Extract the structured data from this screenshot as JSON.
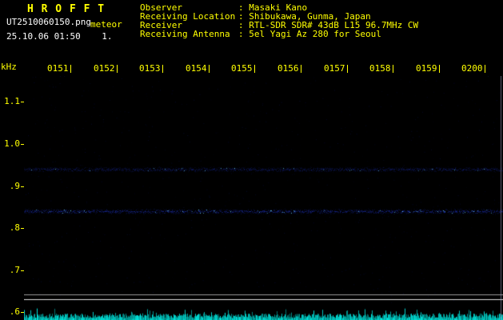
{
  "header": {
    "app_title": "H R O F F T",
    "filename": "UT2510060150.png",
    "mode": "meteor",
    "datetime_line": "25.10.06 01:50    1.",
    "info": [
      {
        "label": "Observer",
        "value": "Masaki Kano"
      },
      {
        "label": "Receiving Location",
        "value": "Shibukawa, Gunma, Japan"
      },
      {
        "label": "Receiver",
        "value": "RTL-SDR SDR# 43dB L15 96.7MHz CW"
      },
      {
        "label": "Receiving Antenna",
        "value": "5el Yagi Az 280 for Seoul"
      }
    ]
  },
  "chart_data": {
    "type": "heatmap",
    "title": "HROFFT meteor radio observation spectrogram",
    "ylabel": "kHz",
    "y_ticks": [
      {
        "label": "1.1",
        "khz": 1.1
      },
      {
        "label": "1.0",
        "khz": 1.0
      },
      {
        "label": ".9",
        "khz": 0.9
      },
      {
        "label": ".8",
        "khz": 0.8
      },
      {
        "label": ".7",
        "khz": 0.7
      },
      {
        "label": ".6",
        "khz": 0.6
      }
    ],
    "x_ticks": [
      "0151",
      "0152",
      "0153",
      "0154",
      "0155",
      "0156",
      "0157",
      "0158",
      "0159",
      "0200"
    ],
    "y_range_khz": [
      0.61,
      1.16
    ],
    "x_range_minutes": [
      "0150",
      "0200"
    ],
    "grid": "off",
    "noise_bands": [
      {
        "khz": 0.94,
        "intensity": 0.55
      },
      {
        "khz": 0.84,
        "intensity": 0.85
      }
    ],
    "baseline_lines_khz": [
      0.641,
      0.63
    ],
    "bottom_strip": {
      "description": "signal amplitude trace (full width, jagged)",
      "color": "#00b8b0"
    },
    "colors": {
      "background": "#000000",
      "axis_text": "#ffff00",
      "band_blue": "#1c30be",
      "speckle_cyan": "#6edcff",
      "baseline": "#d9d9d9",
      "cursor": "#aaafd7"
    }
  }
}
